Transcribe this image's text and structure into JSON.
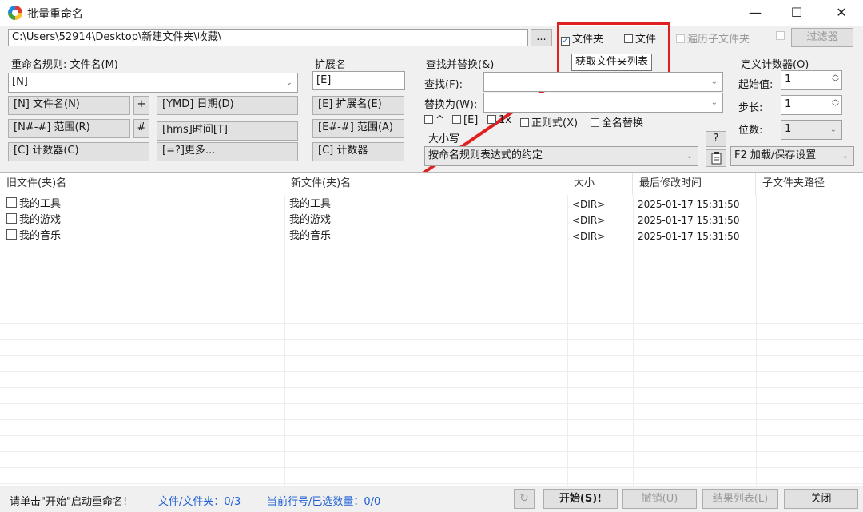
{
  "window": {
    "title": "批量重命名",
    "controls": {
      "minimize": "—",
      "maximize": "☐",
      "close": "✕"
    }
  },
  "toolbar": {
    "path": "C:\\Users\\52914\\Desktop\\新建文件夹\\收藏\\",
    "browse": "...",
    "folders": {
      "label": "文件夹",
      "checked": true
    },
    "files": {
      "label": "文件",
      "checked": false
    },
    "recurse": {
      "label": "遍历子文件夹"
    },
    "filter": "过滤器",
    "tooltip": "获取文件夹列表"
  },
  "rename": {
    "label": "重命名规则: 文件名(M)",
    "value": "[N]",
    "buttons": [
      "[N] 文件名(N)",
      "+",
      "[YMD] 日期(D)",
      "[N#-#] 范围(R)",
      "#",
      "[hms]时间[T]",
      "[C] 计数器(C)",
      "[=?]更多..."
    ]
  },
  "ext": {
    "label": "扩展名",
    "value": "[E]",
    "buttons": [
      "[E] 扩展名(E)",
      "[E#-#] 范围(A)",
      "[C] 计数器"
    ]
  },
  "replace": {
    "label": "查找并替换(&)",
    "find": "查找(F):",
    "replace_with": "替换为(W):",
    "options": [
      "^",
      "[E]",
      "1x",
      "正则式(X)",
      "全名替换"
    ],
    "case_label": "大小写",
    "case_value": "按命名规则表达式的约定",
    "help": "?"
  },
  "counter": {
    "label": "定义计数器(O)",
    "start_label": "起始值:",
    "start_value": "1",
    "step_label": "步长:",
    "step_value": "1",
    "digits_label": "位数:",
    "digits_value": "1",
    "settings": "F2 加载/保存设置"
  },
  "list": {
    "headers": [
      "旧文件(夹)名",
      "新文件(夹)名",
      "大小",
      "最后修改时间",
      "子文件夹路径"
    ],
    "rows": [
      {
        "old": "我的工具",
        "new": "我的工具",
        "size": "<DIR>",
        "modified": "2025-01-17 15:31:50"
      },
      {
        "old": "我的游戏",
        "new": "我的游戏",
        "size": "<DIR>",
        "modified": "2025-01-17 15:31:50"
      },
      {
        "old": "我的音乐",
        "new": "我的音乐",
        "size": "<DIR>",
        "modified": "2025-01-17 15:31:50"
      }
    ]
  },
  "status": {
    "hint": "请单击\"开始\"启动重命名!",
    "count": "文件/文件夹：0/3",
    "selection": "当前行号/已选数量：0/0",
    "start": "开始(S)!",
    "undo": "撤销(U)",
    "results": "结果列表(L)",
    "close": "关闭"
  },
  "colors": {
    "annotation": "#e02020",
    "status_text": "#1e5fd6"
  }
}
